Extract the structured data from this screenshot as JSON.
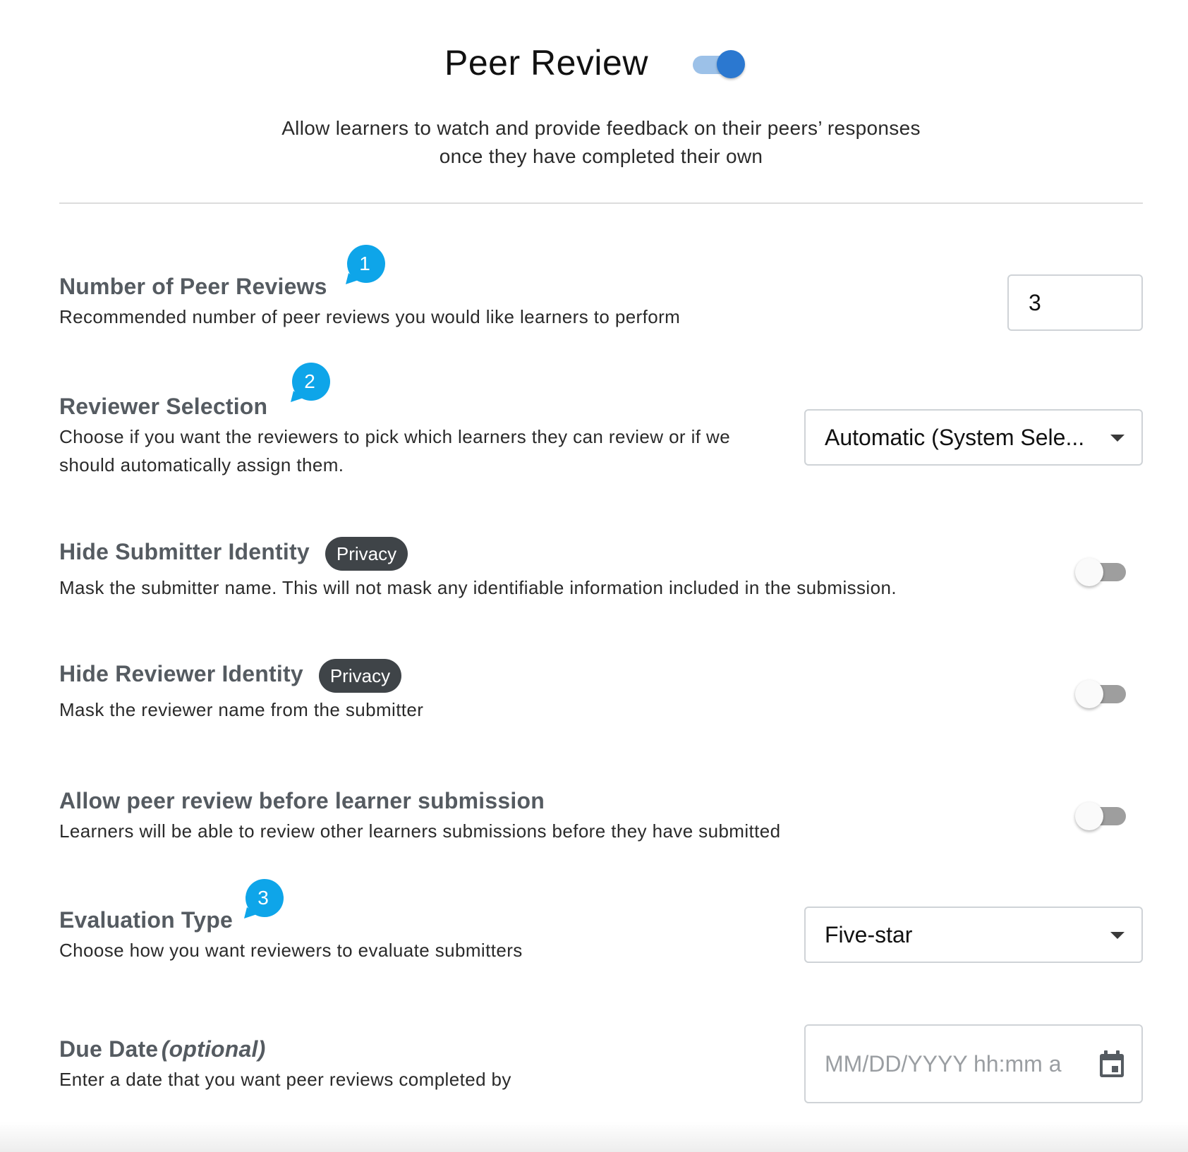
{
  "header": {
    "title": "Peer Review",
    "enabled": true,
    "subtitle_line1": "Allow learners to watch and provide feedback on their peers’ responses",
    "subtitle_line2": "once they have completed their own"
  },
  "settings": {
    "num_reviews": {
      "title": "Number of Peer Reviews",
      "description": "Recommended number of peer reviews you would like learners to perform",
      "value": "3",
      "step_marker": "1"
    },
    "reviewer_selection": {
      "title": "Reviewer Selection",
      "description_line1": "Choose if you want the reviewers to pick which learners they can review or if we",
      "description_line2": "should automatically assign them.",
      "selected": "Automatic (System Sele...",
      "step_marker": "2"
    },
    "hide_submitter": {
      "title": "Hide Submitter Identity",
      "badge": "Privacy",
      "description": "Mask the submitter name. This will not mask any identifiable information included in the submission.",
      "enabled": false
    },
    "hide_reviewer": {
      "title": "Hide Reviewer Identity",
      "badge": "Privacy",
      "description": "Mask the reviewer name from the submitter",
      "enabled": false
    },
    "allow_before_submission": {
      "title": "Allow peer review before learner submission",
      "description": "Learners will be able to review other learners submissions before they have submitted",
      "enabled": false
    },
    "evaluation_type": {
      "title": "Evaluation Type",
      "description": "Choose how you want reviewers to evaluate submitters",
      "selected": "Five-star",
      "step_marker": "3"
    },
    "due_date": {
      "title": "Due Date",
      "title_suffix": "(optional)",
      "description": "Enter a date that you want peer reviews completed by",
      "placeholder": "MM/DD/YYYY hh:mm a",
      "icon": "calendar-icon"
    }
  },
  "colors": {
    "accent": "#2b78d0",
    "bubble": "#0ea5e9",
    "badge": "#3f4448"
  }
}
